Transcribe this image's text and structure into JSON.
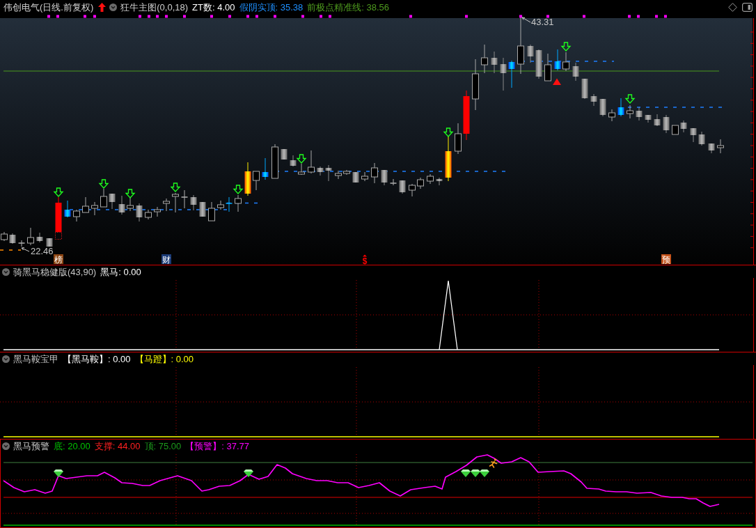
{
  "header": {
    "title": "伟创电气(日线.前复权)",
    "indicator": "狂牛主图(0,0,18)",
    "readings": [
      {
        "label": "ZT数: 4.00",
        "color": "#ffffff"
      },
      {
        "label": "假阴实顶: 35.38",
        "color": "#1e90ff"
      },
      {
        "label": "前极点精准线: 38.56",
        "color": "#4e9a1e"
      }
    ]
  },
  "main_chart": {
    "price_labels": [
      {
        "text": "43.31"
      },
      {
        "text": "22.46"
      }
    ],
    "markers": [
      {
        "label": "榜",
        "kind": "tile",
        "color": "#8b4513"
      },
      {
        "label": "财",
        "kind": "tile",
        "color": "#1c3c78"
      },
      {
        "label": "$",
        "kind": "glyph",
        "color": "#ff0000"
      },
      {
        "label": "预",
        "kind": "tile",
        "color": "#c4521a"
      }
    ]
  },
  "panels": [
    {
      "title": "骑黑马稳健版(43,90)",
      "selected": false,
      "readings": [
        {
          "label": "黑马: 0.00",
          "color": "#ffffff"
        }
      ]
    },
    {
      "title": "黑马鞍宝甲",
      "selected": false,
      "readings": [
        {
          "label": "【黑马鞍】: 0.00",
          "color": "#ffffff"
        },
        {
          "label": "【马蹬】: 0.00",
          "color": "#ffff00"
        }
      ]
    },
    {
      "title": "黑马预警",
      "selected": true,
      "readings": [
        {
          "label": "底: 20.00",
          "color": "#00c000"
        },
        {
          "label": "支撑: 44.00",
          "color": "#ff2020"
        },
        {
          "label": "顶: 75.00",
          "color": "#1c9a1c"
        },
        {
          "label": "【预警】: 37.77",
          "color": "#ff00ff"
        }
      ]
    }
  ]
}
